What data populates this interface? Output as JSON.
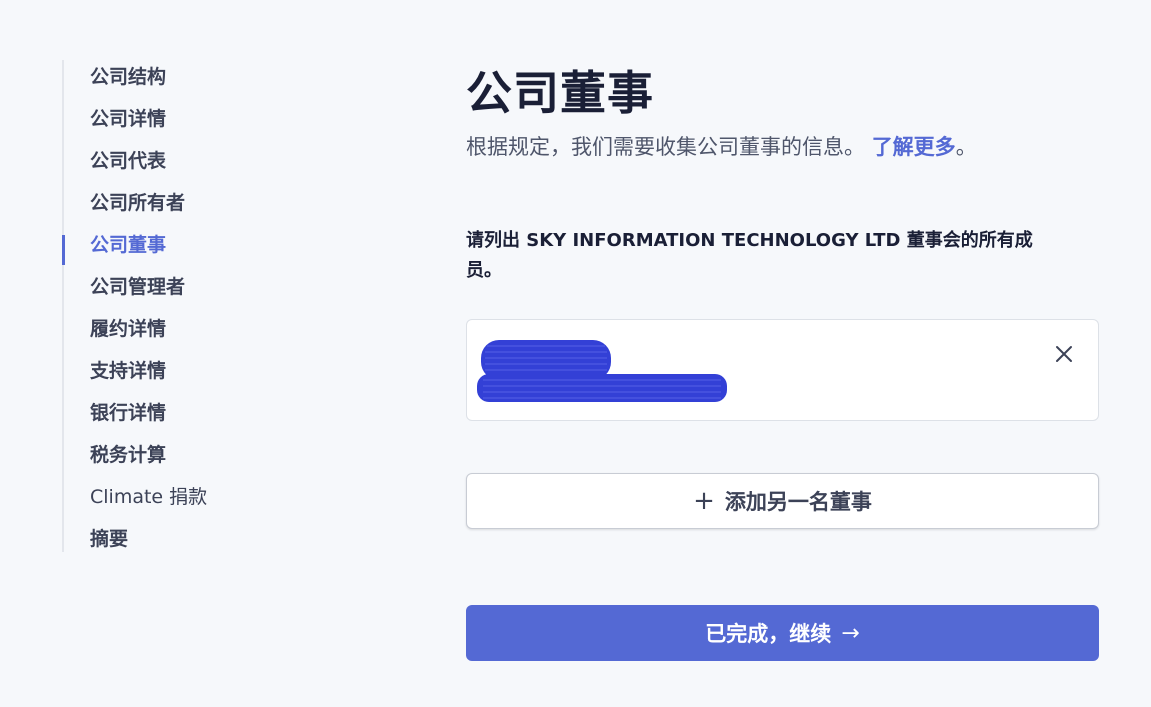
{
  "sidebar": {
    "items": [
      {
        "label": "公司结构"
      },
      {
        "label": "公司详情"
      },
      {
        "label": "公司代表"
      },
      {
        "label": "公司所有者"
      },
      {
        "label": "公司董事"
      },
      {
        "label": "公司管理者"
      },
      {
        "label": "履约详情"
      },
      {
        "label": "支持详情"
      },
      {
        "label": "银行详情"
      },
      {
        "label": "税务计算"
      },
      {
        "label": "Climate 捐款"
      },
      {
        "label": "摘要"
      }
    ],
    "active_item": "公司董事"
  },
  "main": {
    "title": "公司董事",
    "subtitle": "根据规定，我们需要收集公司董事的信息。",
    "learn_more": "了解更多",
    "subtitle_end": "。",
    "list_prompt": "请列出 SKY INFORMATION TECHNOLOGY LTD 董事会的所有成员。",
    "director_card": {
      "remove_icon": "close-icon"
    },
    "add_button_label": "添加另一名董事",
    "continue_button_label": "已完成，继续"
  },
  "colors": {
    "accent": "#5469d4",
    "background": "#f6f8fb",
    "redaction": "#3340d6"
  }
}
